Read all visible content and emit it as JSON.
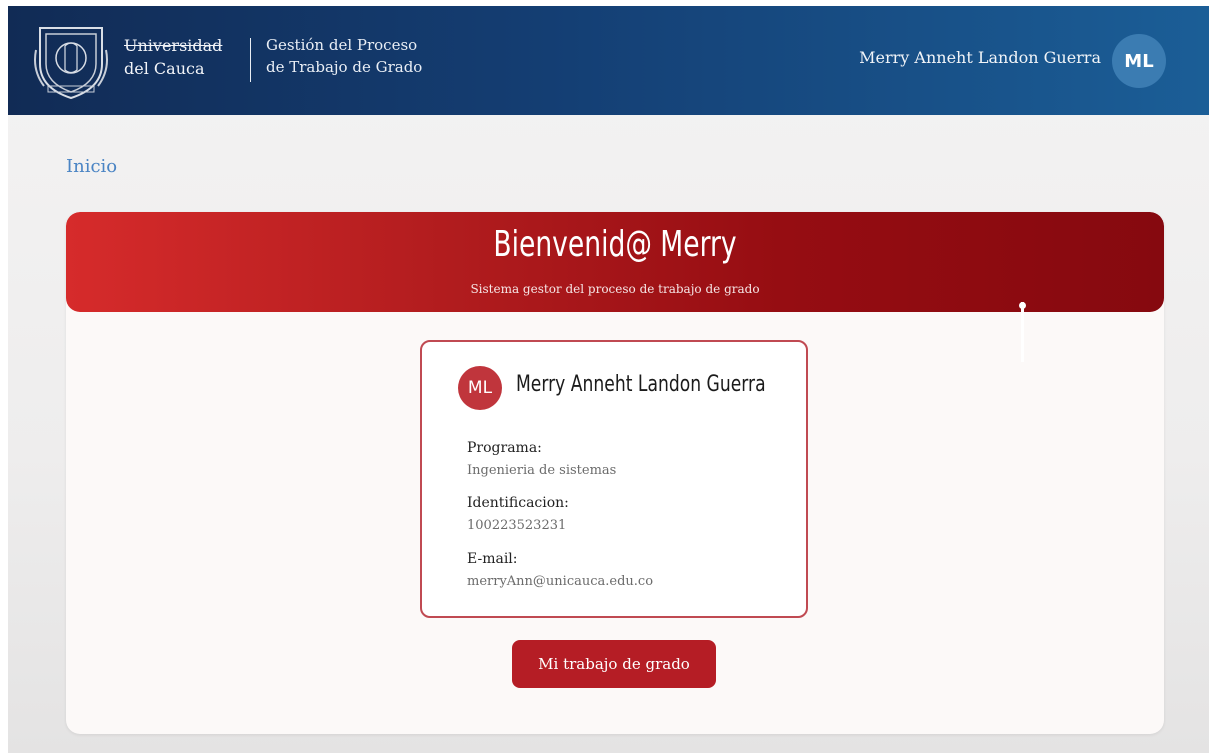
{
  "header": {
    "university_line1": "Universidad",
    "university_line2": "del Cauca",
    "process_line1": "Gestión del Proceso",
    "process_line2": "de Trabajo de Grado",
    "user_name": "Merry Anneht Landon Guerra",
    "user_initials": "ML"
  },
  "breadcrumb": {
    "current": "Inicio"
  },
  "banner": {
    "title": "Bienvenid@ Merry",
    "subtitle": "Sistema gestor del proceso de trabajo de grado"
  },
  "profile": {
    "initials": "ML",
    "name": "Merry Anneht Landon Guerra",
    "fields": [
      {
        "label": "Programa:",
        "value": "Ingenieria de sistemas"
      },
      {
        "label": "Identificacion:",
        "value": "100223523231"
      },
      {
        "label": "E-mail:",
        "value": "merryAnn@unicauca.edu.co"
      }
    ]
  },
  "actions": {
    "thesis_button": "Mi trabajo de grado"
  },
  "colors": {
    "header_blue": "#143e73",
    "banner_red": "#b11c1e",
    "button_red": "#b51d25",
    "link_blue": "#4a84c4"
  }
}
